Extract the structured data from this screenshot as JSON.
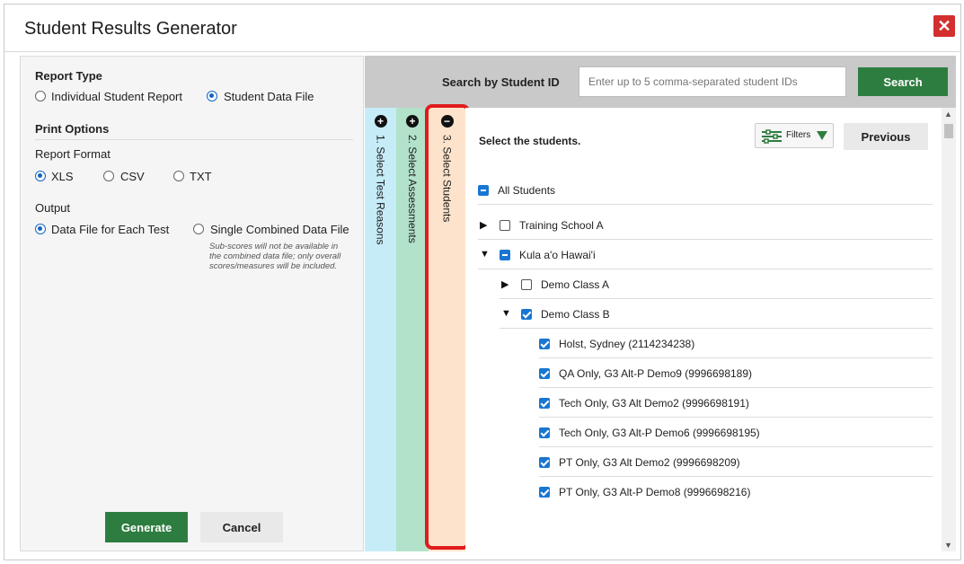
{
  "window": {
    "title": "Student Results Generator",
    "close_icon": "close-icon"
  },
  "left": {
    "report_type": {
      "label": "Report Type",
      "options": [
        {
          "label": "Individual Student Report",
          "selected": false
        },
        {
          "label": "Student Data File",
          "selected": true
        }
      ]
    },
    "print_options": {
      "label": "Print Options"
    },
    "report_format": {
      "label": "Report Format",
      "options": [
        {
          "label": "XLS",
          "selected": true
        },
        {
          "label": "CSV",
          "selected": false
        },
        {
          "label": "TXT",
          "selected": false
        }
      ]
    },
    "output": {
      "label": "Output",
      "options": [
        {
          "label": "Data File for Each Test",
          "selected": true
        },
        {
          "label": "Single Combined Data File",
          "selected": false
        }
      ],
      "note": "Sub-scores will not be available in the combined data file; only overall scores/measures will be included."
    },
    "generate_label": "Generate",
    "cancel_label": "Cancel"
  },
  "search": {
    "label": "Search by Student ID",
    "placeholder": "Enter up to 5 comma-separated student IDs",
    "button_label": "Search"
  },
  "steps": [
    {
      "label": "1. Select Test Reasons",
      "icon": "+",
      "color": "#c6ecf8"
    },
    {
      "label": "2. Select Assessments",
      "icon": "+",
      "color": "#b2e2c9"
    },
    {
      "label": "3. Select Students",
      "icon": "−",
      "color": "#fde3cb"
    }
  ],
  "students": {
    "title": "Select the students.",
    "filters_label": "Filters",
    "previous_label": "Previous",
    "tree": [
      {
        "label": "All Students",
        "state": "partial",
        "level": 0,
        "arrow": ""
      },
      {
        "label": "Training School A",
        "state": "unchecked",
        "level": 1,
        "arrow": "collapsed"
      },
      {
        "label": "Kula a'o Hawai'i",
        "state": "partial",
        "level": 1,
        "arrow": "expanded"
      },
      {
        "label": "Demo Class A",
        "state": "unchecked",
        "level": 2,
        "arrow": "collapsed"
      },
      {
        "label": "Demo Class B",
        "state": "checked",
        "level": 2,
        "arrow": "expanded"
      },
      {
        "label": "Holst, Sydney (2114234238)",
        "state": "checked",
        "level": 3,
        "arrow": ""
      },
      {
        "label": "QA Only, G3 Alt-P Demo9 (9996698189)",
        "state": "checked",
        "level": 3,
        "arrow": ""
      },
      {
        "label": "Tech Only, G3 Alt Demo2 (9996698191)",
        "state": "checked",
        "level": 3,
        "arrow": ""
      },
      {
        "label": "Tech Only, G3 Alt-P Demo6 (9996698195)",
        "state": "checked",
        "level": 3,
        "arrow": ""
      },
      {
        "label": "PT Only, G3 Alt Demo2 (9996698209)",
        "state": "checked",
        "level": 3,
        "arrow": ""
      },
      {
        "label": "PT Only, G3 Alt-P Demo8 (9996698216)",
        "state": "checked",
        "level": 3,
        "arrow": ""
      }
    ]
  }
}
